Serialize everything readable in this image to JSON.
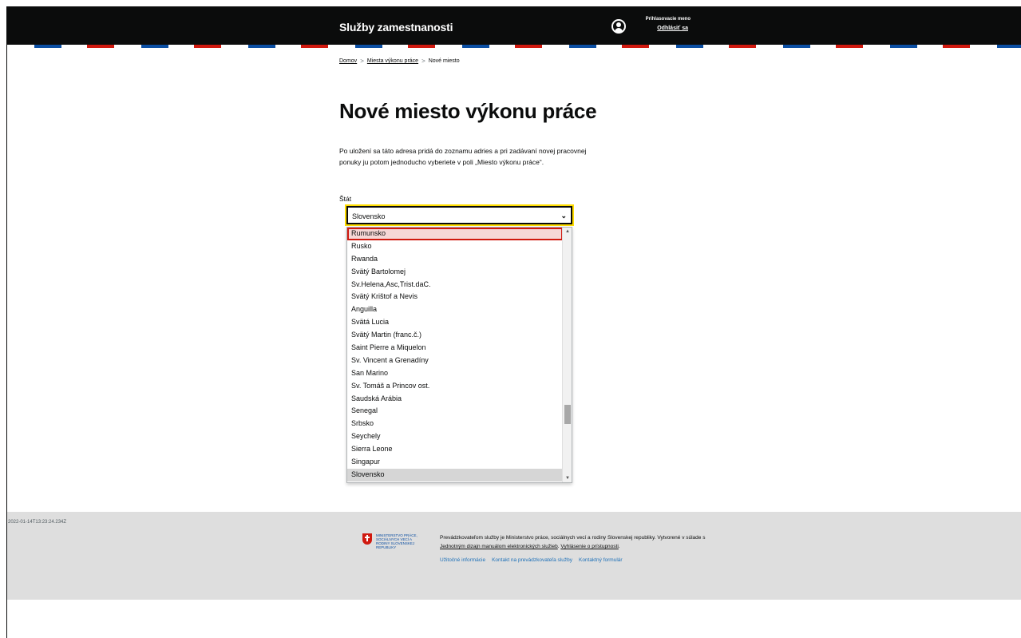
{
  "header": {
    "brand": "Služby zamestnanosti",
    "login_name": "Prihlasovacie meno",
    "logout_label": "Odhlásiť sa",
    "stripe_colors": [
      "#ffffff",
      "#0b4ea2",
      "#d0190f"
    ]
  },
  "breadcrumb": {
    "home": "Domov",
    "sep1": ">",
    "places": "Miesta výkonu práce",
    "sep2": ">",
    "current": "Nové miesto"
  },
  "main": {
    "title": "Nové miesto výkonu práce",
    "intro": "Po uložení sa táto adresa pridá do zoznamu adries a pri zadávaní novej pracovnej ponuky ju potom jednoducho vyberiete v poli „Miesto výkonu práce“.",
    "field_label": "Štát",
    "selected_value": "Slovensko"
  },
  "dropdown": {
    "highlighted": "Rumunsko",
    "options": [
      "Rumunsko",
      "Rusko",
      "Rwanda",
      "Svätý Bartolomej",
      "Sv.Helena,Asc,Trist.daC.",
      "Svätý Krištof a Nevis",
      "Anguilla",
      "Svätá Lucia",
      "Svätý Martin (franc.č.)",
      "Saint Pierre a Miquelon",
      "Sv. Vincent a Grenadíny",
      "San Marino",
      "Sv. Tomáš a Princov ost.",
      "Saudská Arábia",
      "Senegal",
      "Srbsko",
      "Seychely",
      "Sierra Leone",
      "Singapur",
      "Slovensko"
    ],
    "selected": "Slovensko"
  },
  "footer": {
    "timestamp": "2022-01-14T13:23:24.234Z",
    "ministry_name": "Ministerstvo práce, sociálnych vecí a rodiny Slovenskej republiky",
    "text_1": "Prevádzkovateľom služby je Ministerstvo práce, sociálnych vecí a rodiny Slovenskej republiky. Vytvorené v súlade s ",
    "link_design": "Jednotným dizajn manuálom elektronických služieb",
    "text_2": ". ",
    "link_accessibility": "Vyhlásenie o prístupnosti",
    "text_3": ".",
    "links": [
      "Užitočné informácie",
      "Kontakt na prevádzkovateľa služby",
      "Kontaktný formulár"
    ]
  }
}
